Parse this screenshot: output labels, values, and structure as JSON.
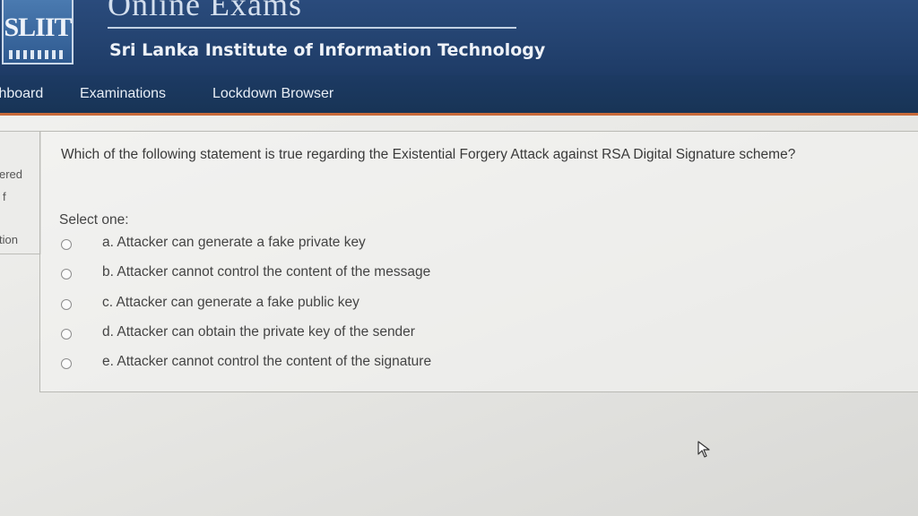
{
  "header": {
    "logo_text": "SLIIT",
    "site_name": "Online Exams",
    "institute": "Sri Lanka Institute of Information Technology"
  },
  "nav": {
    "items": [
      "Dashboard",
      "Examinations",
      "Lockdown Browser"
    ]
  },
  "sidebar_fragments": [
    "ered",
    "f",
    "tion"
  ],
  "quiz": {
    "question": "Which of the following statement is true regarding the Existential Forgery Attack against RSA Digital Signature scheme?",
    "select_prompt": "Select one:",
    "options": [
      "a. Attacker can generate a fake private key",
      "b. Attacker cannot control the content of the message",
      "c. Attacker can generate a fake public key",
      "d. Attacker can obtain the private key of the sender",
      "e. Attacker cannot control the content of the signature"
    ]
  },
  "colors": {
    "header_bg": "#23426f",
    "navbar_bg": "#1c3a63",
    "nav_accent": "#c86a3a",
    "page_bg": "#e8e8e5"
  }
}
